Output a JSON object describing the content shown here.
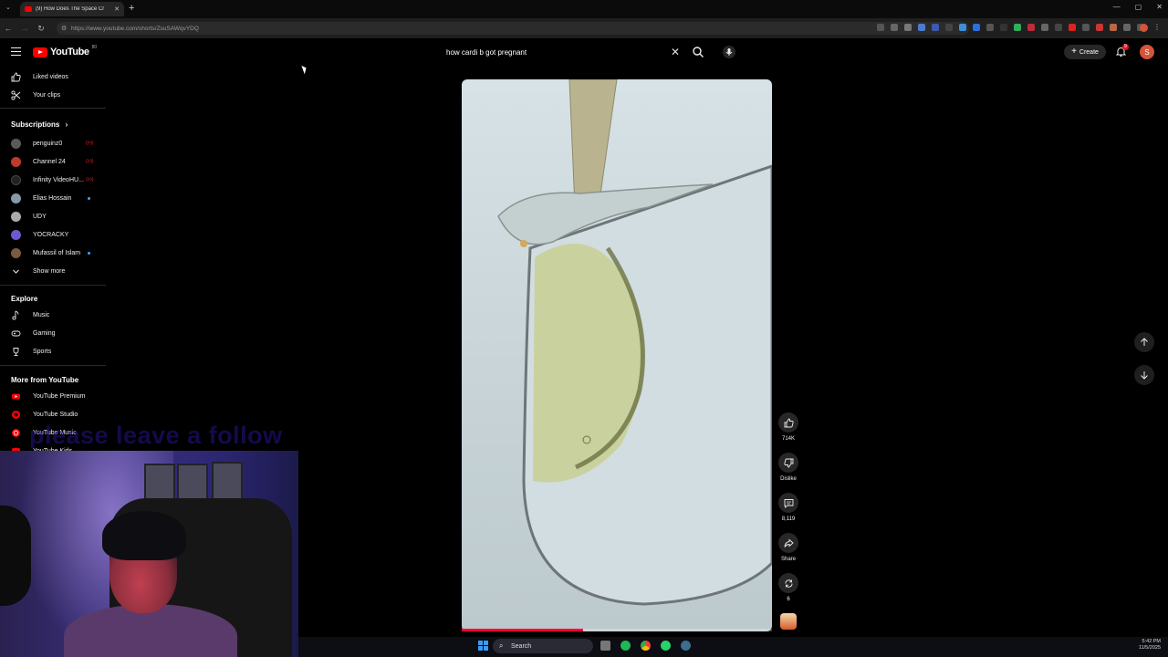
{
  "browser": {
    "tab_title": "(9) How Does The Space Cr",
    "new_tab": "+",
    "url": "https://www.youtube.com/shorts/ZsuSAWqvYDQ",
    "tab_close": "✕",
    "tab_menu": "⌄",
    "window_controls": [
      "—",
      "▢",
      "✕"
    ]
  },
  "header": {
    "logo_text": "YouTube",
    "logo_badge": "80",
    "search_query": "how cardi b got pregnant",
    "search_clear": "✕",
    "create_label": "Create",
    "create_plus": "+",
    "notification_count": "9",
    "avatar_letter": "S"
  },
  "sidebar": {
    "top_items": [
      {
        "label": "Liked videos",
        "icon": "thumbs-up-icon"
      },
      {
        "label": "Your clips",
        "icon": "scissors-icon"
      }
    ],
    "subscriptions_title": "Subscriptions",
    "subscriptions_chevron": "›",
    "subscriptions": [
      {
        "label": "penguinz0",
        "status": "live",
        "live_text": "((•))",
        "color": "#5a5a5a"
      },
      {
        "label": "Channel 24",
        "status": "live",
        "live_text": "((•))",
        "color": "#c0392b"
      },
      {
        "label": "Infinity VideoHU...",
        "status": "live",
        "live_text": "((•))",
        "color": "#222222"
      },
      {
        "label": "Elias Hossain",
        "status": "new",
        "color": "#8899aa"
      },
      {
        "label": "UDY",
        "status": "none",
        "color": "#aaaaaa"
      },
      {
        "label": "YOCRACKY",
        "status": "none",
        "color": "#6a5acd"
      },
      {
        "label": "Mufassil of Islam",
        "status": "new",
        "color": "#7a5a40"
      }
    ],
    "show_more": "Show more",
    "explore_title": "Explore",
    "explore": [
      {
        "label": "Music",
        "icon": "music-note-icon"
      },
      {
        "label": "Gaming",
        "icon": "gamepad-icon"
      },
      {
        "label": "Sports",
        "icon": "trophy-icon"
      }
    ],
    "more_title": "More from YouTube",
    "more": [
      {
        "label": "YouTube Premium"
      },
      {
        "label": "YouTube Studio"
      },
      {
        "label": "YouTube Music"
      },
      {
        "label": "YouTube Kids"
      }
    ]
  },
  "overlay": {
    "text": "please leave a follow"
  },
  "short": {
    "progress_percent": 39,
    "actions": {
      "like_count": "714K",
      "dislike_label": "Dislike",
      "comments_count": "8,119",
      "share_label": "Share",
      "remix_count": "6"
    }
  },
  "taskbar": {
    "search_label": "Search",
    "time": "5:42 PM",
    "date": "11/5/2025"
  },
  "colors": {
    "accent_red": "#ff0000",
    "progress_red": "#ff0033",
    "windows_blue": "#3b9bf5"
  }
}
